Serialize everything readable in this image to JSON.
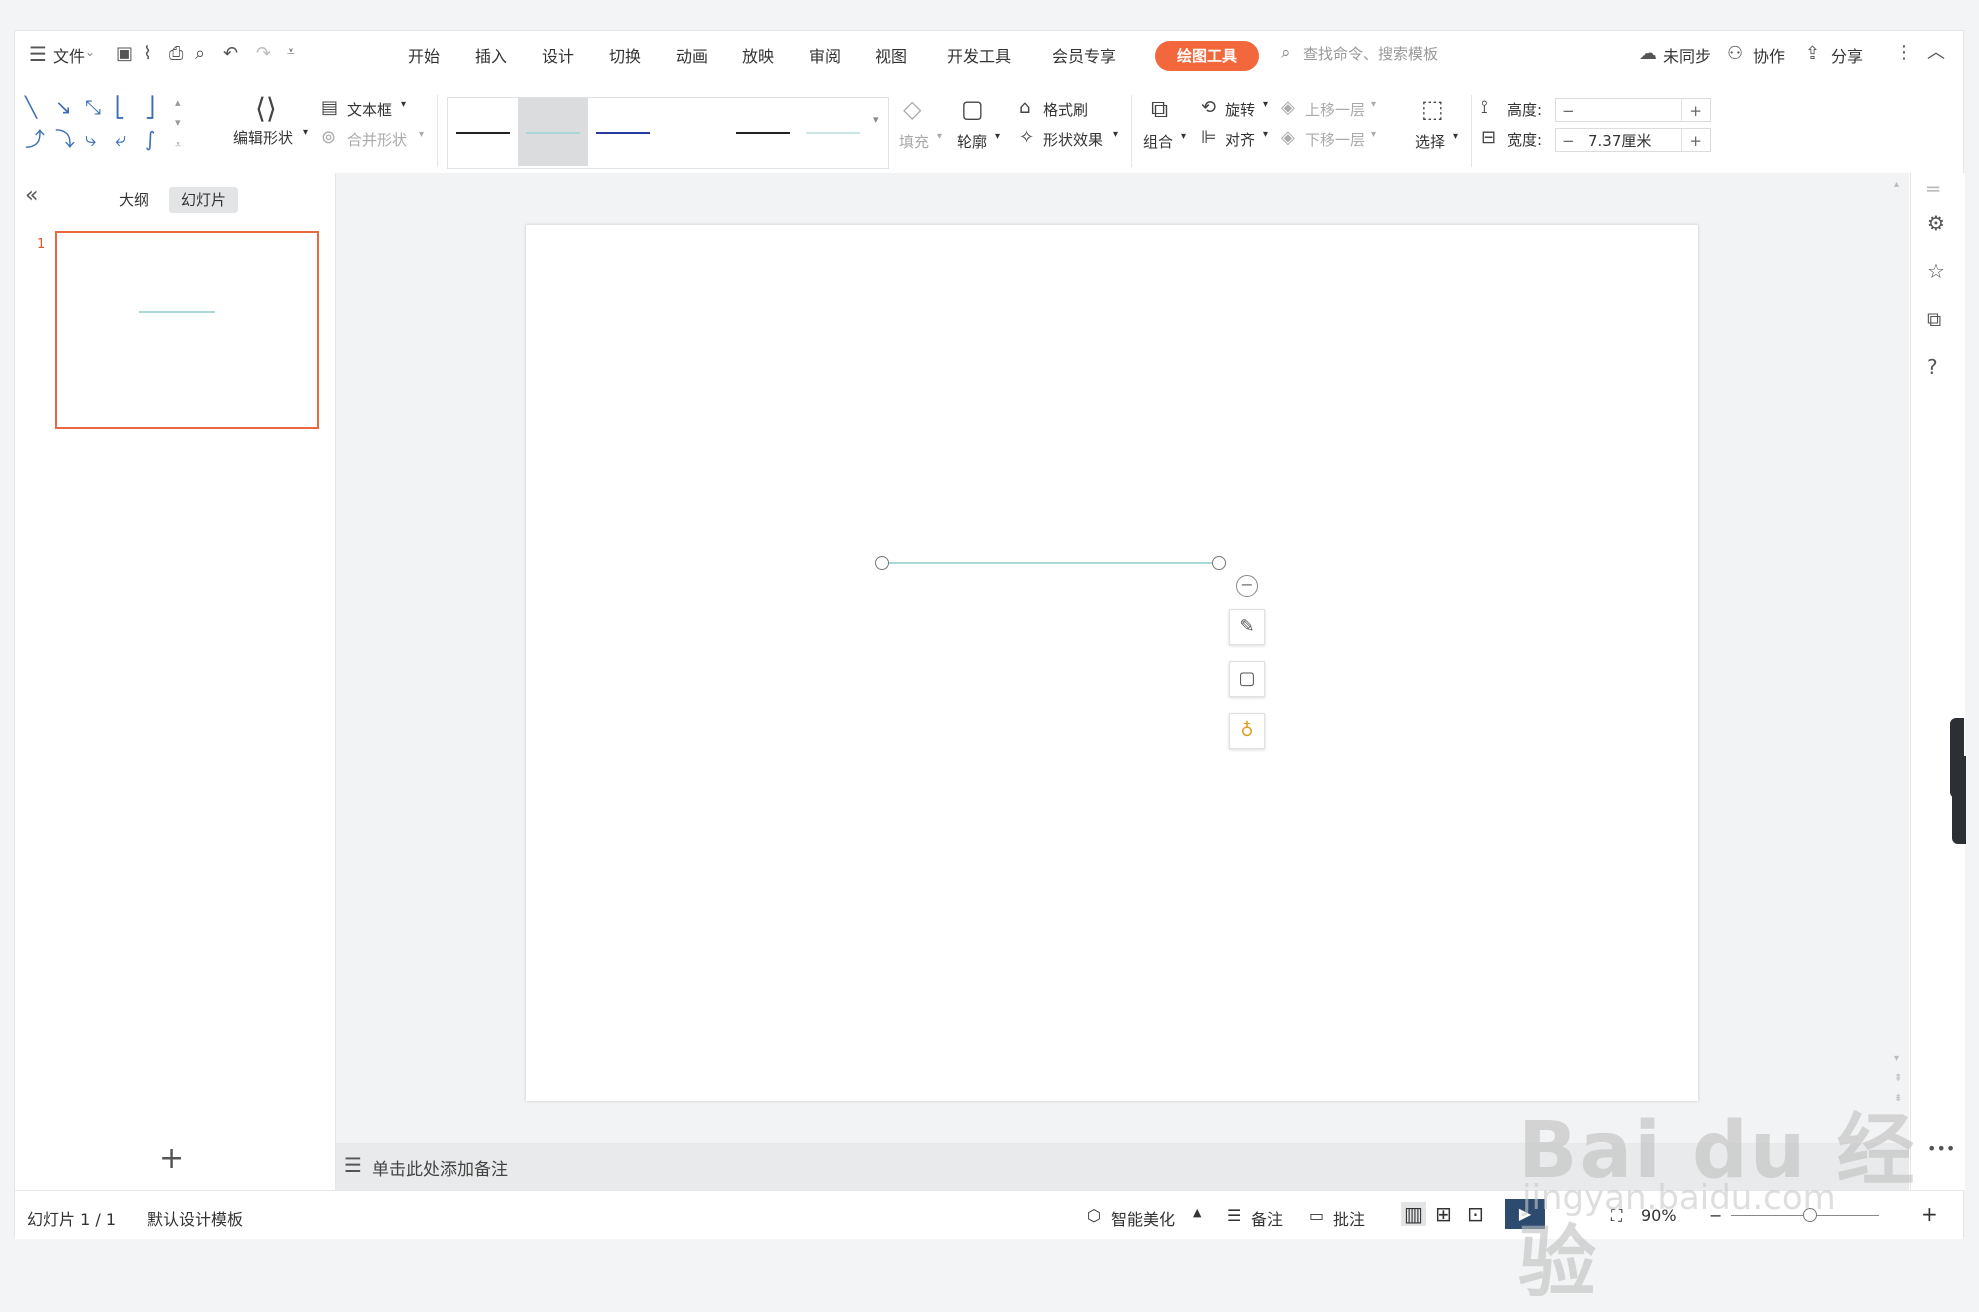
{
  "menubar": {
    "file": "文件",
    "tabs": [
      "开始",
      "插入",
      "设计",
      "切换",
      "动画",
      "放映",
      "审阅",
      "视图",
      "开发工具",
      "会员专享"
    ],
    "drawing_tools": "绘图工具",
    "search_placeholder": "查找命令、搜索模板",
    "sync": "未同步",
    "collab": "协作",
    "share": "分享"
  },
  "ribbon": {
    "edit_shape": "编辑形状",
    "text_box": "文本框",
    "merge_shape": "合并形状",
    "fill": "填充",
    "outline": "轮廓",
    "format_painter": "格式刷",
    "shape_effect": "形状效果",
    "group": "组合",
    "rotate": "旋转",
    "align": "对齐",
    "bring_forward": "上移一层",
    "send_backward": "下移一层",
    "select": "选择",
    "height_label": "高度:",
    "width_label": "宽度:",
    "height_value": "",
    "width_value": "7.37厘米",
    "line_styles": [
      {
        "color": "#222222"
      },
      {
        "color": "#a9d8d6"
      },
      {
        "color": "#2b3a9e"
      },
      {
        "color": "#ffffff"
      },
      {
        "color": "#222222"
      },
      {
        "color": "#c9e6e4"
      }
    ]
  },
  "leftpanel": {
    "tab_outline": "大纲",
    "tab_slides": "幻灯片",
    "slide_number": "1",
    "collapse": "«",
    "add": "+"
  },
  "notes": {
    "placeholder": "单击此处添加备注"
  },
  "status": {
    "slide_info": "幻灯片 1 / 1",
    "template": "默认设计模板",
    "beautify": "智能美化",
    "notes": "备注",
    "comment": "批注",
    "zoom": "90%"
  },
  "watermark": {
    "line1": "Bai du 经验",
    "line2": "jingyan.baidu.com"
  }
}
